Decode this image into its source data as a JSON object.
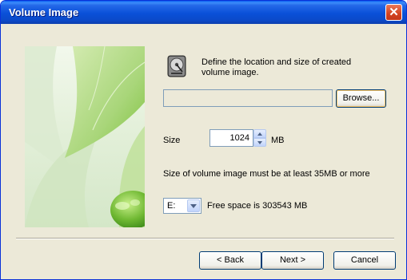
{
  "window": {
    "title": "Volume Image",
    "close_label": "✕"
  },
  "content": {
    "description": "Define the location and size of created volume image.",
    "path_value": "",
    "browse_label": "Browse...",
    "size_label": "Size",
    "size_value": "1024",
    "size_unit": "MB",
    "hint": "Size of volume image must be at least 35MB or more",
    "drive_value": "E:",
    "free_space": "Free space is 303543 MB"
  },
  "footer": {
    "back_label": "< Back",
    "next_label": "Next >",
    "cancel_label": "Cancel"
  },
  "icons": {
    "disk": "hard-disk-icon",
    "close": "close-icon"
  },
  "colors": {
    "title_bar": "#0a50d8",
    "dialog_face": "#ece9d8",
    "close_button": "#d2421f",
    "accent": "#7cc03a"
  }
}
